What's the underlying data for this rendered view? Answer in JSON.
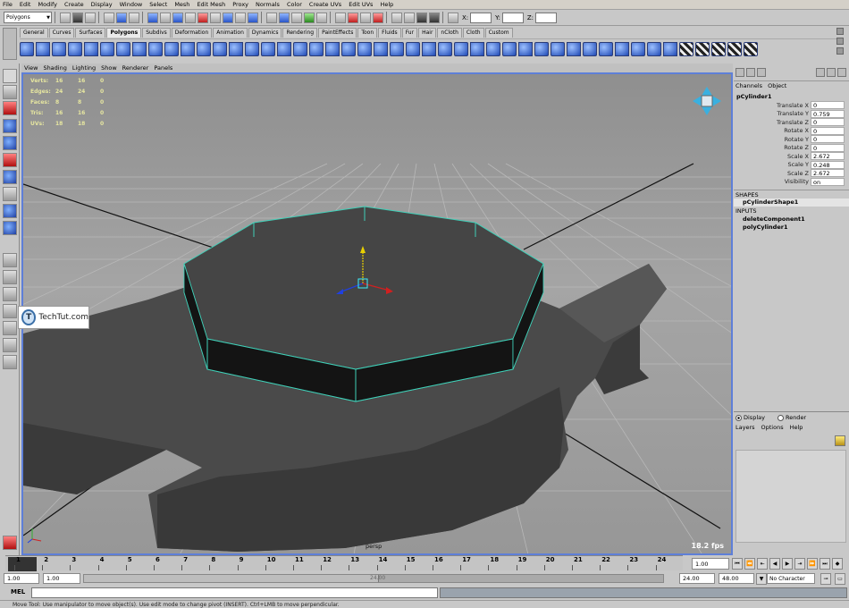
{
  "menubar": [
    "File",
    "Edit",
    "Modify",
    "Create",
    "Display",
    "Window",
    "Select",
    "Mesh",
    "Edit Mesh",
    "Proxy",
    "Normals",
    "Color",
    "Create UVs",
    "Edit UVs",
    "Help"
  ],
  "statusline": {
    "mode": "Polygons",
    "x_label": "X:",
    "y_label": "Y:",
    "z_label": "Z:"
  },
  "shelf_tabs": [
    "General",
    "Curves",
    "Surfaces",
    "Polygons",
    "Subdivs",
    "Deformation",
    "Animation",
    "Dynamics",
    "Rendering",
    "PaintEffects",
    "Toon",
    "Fluids",
    "Fur",
    "Hair",
    "nCloth",
    "Cloth",
    "Custom"
  ],
  "shelf_active": "Polygons",
  "viewport": {
    "menu": [
      "View",
      "Shading",
      "Lighting",
      "Show",
      "Renderer",
      "Panels"
    ],
    "hud": [
      {
        "label": "Verts:",
        "v1": "16",
        "v2": "16",
        "v3": "0"
      },
      {
        "label": "Edges:",
        "v1": "24",
        "v2": "24",
        "v3": "0"
      },
      {
        "label": "Faces:",
        "v1": "8",
        "v2": "8",
        "v3": "0"
      },
      {
        "label": "Tris:",
        "v1": "16",
        "v2": "16",
        "v3": "0"
      },
      {
        "label": "UVs:",
        "v1": "18",
        "v2": "18",
        "v3": "0"
      }
    ],
    "fps": "18.2 fps",
    "camera": "persp",
    "watermark": "TechTut.com",
    "watermark_logo": "T"
  },
  "channelbox": {
    "menu": [
      "Channels",
      "Object"
    ],
    "object": "pCylinder1",
    "attrs": [
      {
        "label": "Translate X",
        "value": "0"
      },
      {
        "label": "Translate Y",
        "value": "0.759"
      },
      {
        "label": "Translate Z",
        "value": "0"
      },
      {
        "label": "Rotate X",
        "value": "0"
      },
      {
        "label": "Rotate Y",
        "value": "0"
      },
      {
        "label": "Rotate Z",
        "value": "0"
      },
      {
        "label": "Scale X",
        "value": "2.672"
      },
      {
        "label": "Scale Y",
        "value": "0.248"
      },
      {
        "label": "Scale Z",
        "value": "2.672"
      },
      {
        "label": "Visibility",
        "value": "on"
      }
    ],
    "shapes_header": "SHAPES",
    "shape": "pCylinderShape1",
    "inputs_header": "INPUTS",
    "inputs": [
      "deleteComponent1",
      "polyCylinder1"
    ]
  },
  "layer_editor": {
    "display": "Display",
    "render": "Render",
    "menu": [
      "Layers",
      "Options",
      "Help"
    ]
  },
  "timeslider": {
    "ticks": [
      "1",
      "2",
      "3",
      "4",
      "5",
      "6",
      "7",
      "8",
      "9",
      "10",
      "11",
      "12",
      "13",
      "14",
      "15",
      "16",
      "17",
      "18",
      "19",
      "20",
      "21",
      "22",
      "23",
      "24"
    ],
    "current": "1.00"
  },
  "range": {
    "start": "1.00",
    "inner_start": "1.00",
    "thumb_label": "24.00",
    "end": "24.00",
    "outer_end": "48.00",
    "charset": "No Character Set"
  },
  "cmd": {
    "label": "MEL"
  },
  "helpline": "Move Tool: Use manipulator to move object(s). Use edit mode to change pivot (INSERT). Ctrl+LMB to move perpendicular."
}
